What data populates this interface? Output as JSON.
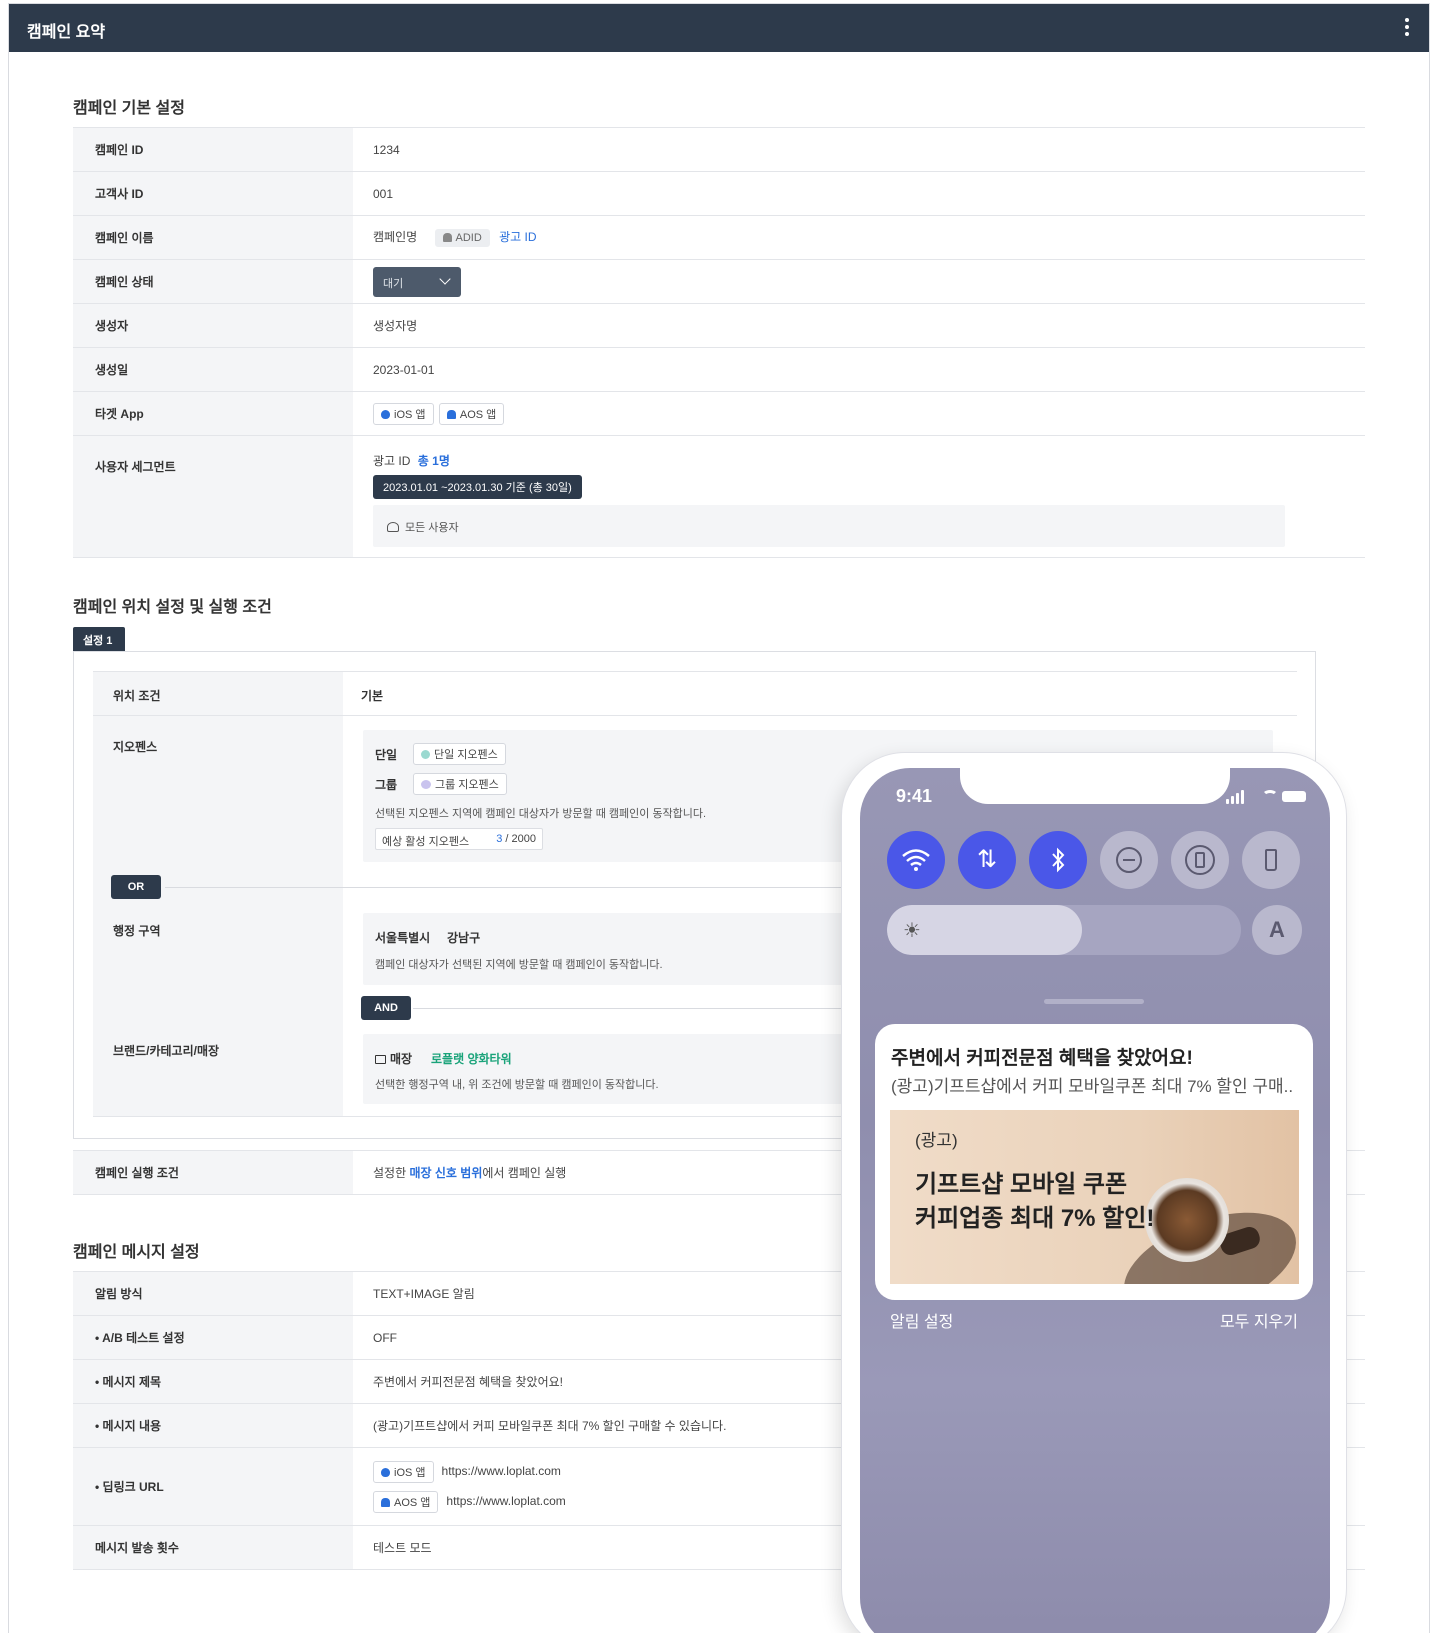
{
  "topbar": {
    "title": "캠페인 요약"
  },
  "basic": {
    "title": "캠페인 기본 설정",
    "rows": {
      "campaign_id": {
        "label": "캠페인 ID",
        "value": "1234"
      },
      "client_id": {
        "label": "고객사 ID",
        "value": "001"
      },
      "campaign_name": {
        "label": "캠페인 이름",
        "value": "캠페인명",
        "adid_chip": "ADID",
        "adid_link": "광고 ID"
      },
      "status": {
        "label": "캠페인 상태",
        "value": "대기"
      },
      "creator": {
        "label": "생성자",
        "value": "생성자명"
      },
      "created": {
        "label": "생성일",
        "value": "2023-01-01"
      },
      "target_app": {
        "label": "타겟 App",
        "ios": "iOS 앱",
        "aos": "AOS 앱"
      },
      "segment": {
        "label": "사용자 세그먼트",
        "ad_id": "광고 ID",
        "total": "총 1명",
        "period": "2023.01.01 ~2023.01.30 기준 (총 30일)",
        "all_users": "모든 사용자"
      }
    }
  },
  "location": {
    "title": "캠페인 위치 설정 및 실행 조건",
    "tab": "설정 1",
    "loc_cond_label": "위치 조건",
    "loc_cond_value": "기본",
    "geofence_label": "지오펜스",
    "single_label": "단일",
    "single_chip": "단일 지오펜스",
    "group_label": "그룹",
    "group_chip": "그룹 지오펜스",
    "geofence_note": "선택된 지오펜스 지역에 캠페인 대상자가 방문할 때 캠페인이 동작합니다.",
    "expected_label": "예상 활성 지오펜스",
    "expected_count": "3",
    "expected_total": " / 2000",
    "or_badge": "OR",
    "admin_label": "행정 구역",
    "city": "서울특별시",
    "district": "강남구",
    "admin_note": "캠페인 대상자가 선택된 지역에 방문할 때 캠페인이 동작합니다.",
    "and_badge": "AND",
    "brand_label": "브랜드/카테고리/매장",
    "store_label": "매장",
    "store_value": "로플랫 양화타워",
    "brand_note": "선택한 행정구역 내, 위 조건에 방문할 때 캠페인이 동작합니다.",
    "exec_label": "캠페인 실행 조건",
    "exec_pre": "설정한 ",
    "exec_link": "매장 신호 범위",
    "exec_post": "에서 캠페인 실행"
  },
  "message": {
    "title": "캠페인 메시지 설정",
    "rows": {
      "notify": {
        "label": "알림 방식",
        "value": "TEXT+IMAGE 알림"
      },
      "ab": {
        "label": "• A/B 테스트 설정",
        "value": "OFF"
      },
      "msg_title": {
        "label": "• 메시지 제목",
        "value": "주변에서 커피전문점 혜택을 찾았어요!"
      },
      "msg_body": {
        "label": "• 메시지 내용",
        "value": "(광고)기프트샵에서 커피 모바일쿠폰 최대 7% 할인 구매할 수 있습니다."
      },
      "deeplink": {
        "label": "• 딥링크 URL",
        "ios": "iOS 앱",
        "ios_url": "https://www.loplat.com",
        "aos": "AOS 앱",
        "aos_url": "https://www.loplat.com"
      },
      "send_count": {
        "label": "메시지 발송 횟수",
        "value": "테스트 모드"
      }
    }
  },
  "phone": {
    "time": "9:41",
    "auto_brightness": "A",
    "brightness_level": 0.55,
    "notif_title": "주변에서 커피전문점 혜택을 찾았어요!",
    "notif_body": "(광고)기프트샵에서 커피 모바일쿠폰 최대 7% 할인 구매..",
    "img_ad": "(광고)",
    "img_line1": "기프트샵 모바일 쿠폰",
    "img_line2": "커피업종 최대 7% 할인!",
    "footer_left": "알림 설정",
    "footer_right": "모두 지우기"
  },
  "colors": {
    "topbar": "#2d3a4b",
    "link": "#2a6fdb",
    "green": "#1aa37a",
    "toggle_on": "#4a57e8"
  }
}
